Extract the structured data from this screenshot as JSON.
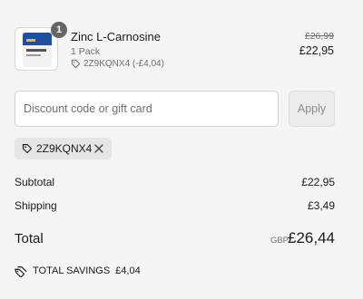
{
  "product": {
    "quantity": "1",
    "name": "Zinc L-Carnosine",
    "variant": "1 Pack",
    "discount_line": "2Z9KQNX4 (-£4,04)",
    "original_price": "£26,99",
    "price": "£22,95",
    "thumbnail_icon": "supplement-pouch-icon"
  },
  "discount": {
    "placeholder": "Discount code or gift card",
    "apply_label": "Apply",
    "applied_code": "2Z9KQNX4"
  },
  "summary": {
    "subtotal_label": "Subtotal",
    "subtotal_value": "£22,95",
    "shipping_label": "Shipping",
    "shipping_value": "£3,49",
    "total_label": "Total",
    "currency": "GBP",
    "total_value": "£26,44",
    "savings_label": "TOTAL SAVINGS",
    "savings_value": "£4,04"
  },
  "colors": {
    "background": "#f5f5f5",
    "text": "#1a1a1a",
    "muted": "#707070",
    "chip_background": "#e6e6e6",
    "badge": "#666666"
  }
}
